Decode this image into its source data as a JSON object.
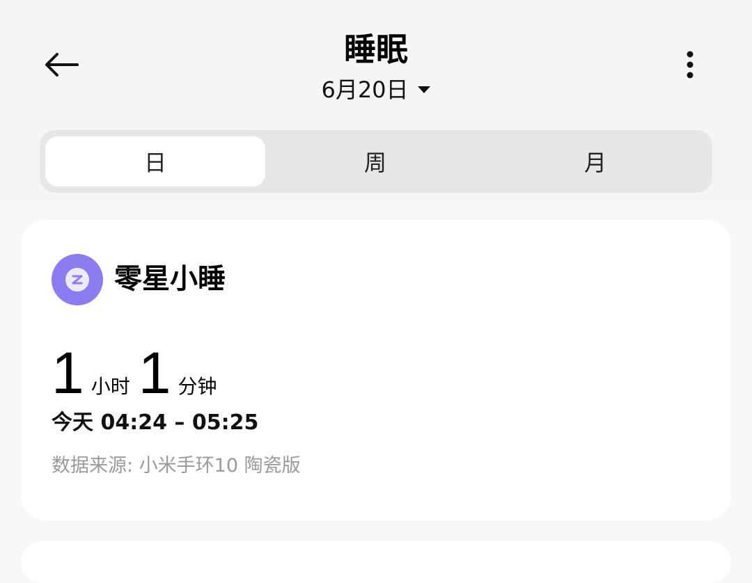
{
  "header": {
    "title": "睡眠",
    "date": "6月20日",
    "back_icon": "arrow-left-icon",
    "more_icon": "more-vertical-icon",
    "dropdown_icon": "caret-down-icon"
  },
  "tabs": [
    {
      "label": "日",
      "active": true
    },
    {
      "label": "周",
      "active": false
    },
    {
      "label": "月",
      "active": false
    }
  ],
  "nap_card": {
    "icon": "nap-z-icon",
    "icon_color": "#8b7cf2",
    "title": "零星小睡",
    "hours": "1",
    "hours_unit": "小时",
    "minutes": "1",
    "minutes_unit": "分钟",
    "time_range": "今天 04:24 – 05:25",
    "source": "数据来源: 小米手环10 陶瓷版"
  }
}
